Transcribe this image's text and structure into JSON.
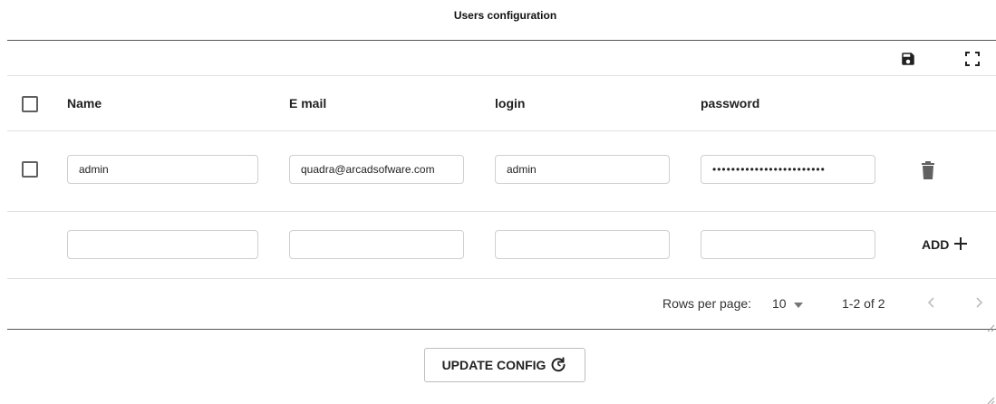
{
  "title": "Users configuration",
  "toolbar": {
    "save_icon": "save-icon",
    "fullscreen_icon": "fullscreen-icon"
  },
  "columns": [
    "Name",
    "E mail",
    "login",
    "password"
  ],
  "rows": [
    {
      "name": "admin",
      "email": "quadra@arcadsofware.com",
      "login": "admin",
      "password": "••••••••••••••••••••••••"
    }
  ],
  "new_row": {
    "name": "",
    "email": "",
    "login": "",
    "password": "",
    "add_label": "ADD"
  },
  "pagination": {
    "rows_per_page_label": "Rows per page:",
    "rows_per_page_value": "10",
    "range": "1-2 of 2"
  },
  "update_button": {
    "label": "UPDATE CONFIG"
  }
}
